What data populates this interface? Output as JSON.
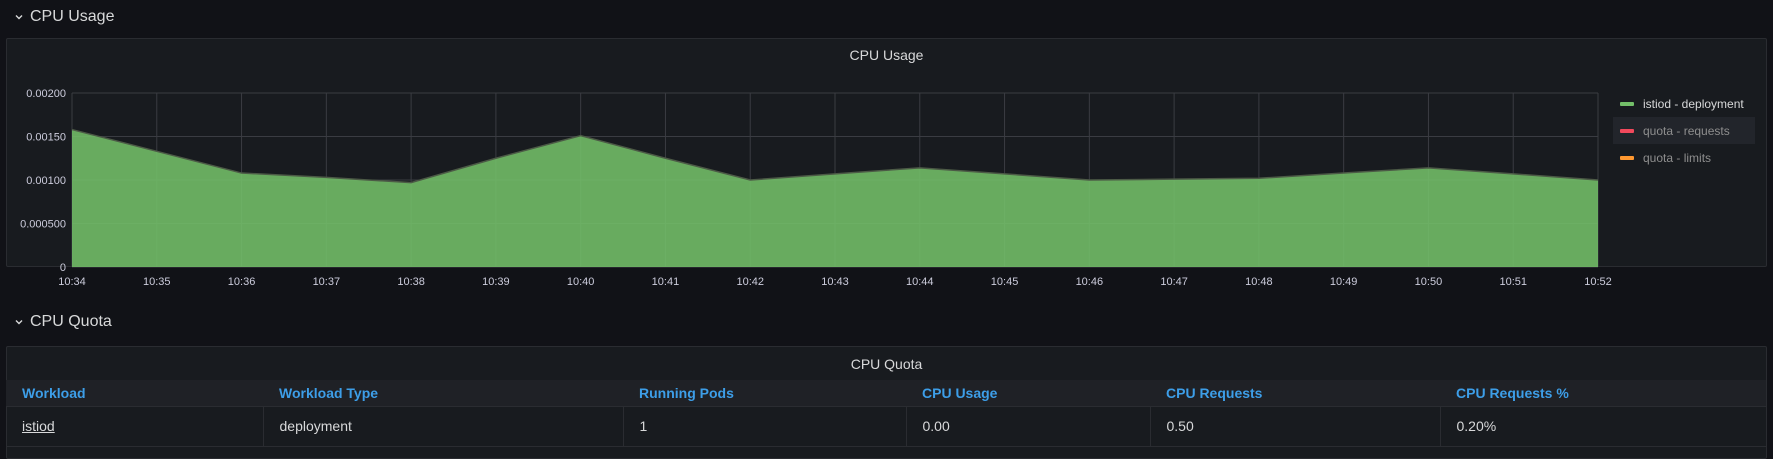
{
  "rows": {
    "cpu_usage": {
      "title": "CPU Usage"
    },
    "cpu_quota": {
      "title": "CPU Quota"
    }
  },
  "usage_panel": {
    "title": "CPU Usage",
    "legend": [
      {
        "label": "istiod - deployment",
        "color": "#73bf69",
        "state": "active"
      },
      {
        "label": "quota - requests",
        "color": "#f2495c",
        "state": "dim"
      },
      {
        "label": "quota - limits",
        "color": "#ff9830",
        "state": "dim"
      }
    ]
  },
  "quota_panel": {
    "title": "CPU Quota",
    "columns": [
      "Workload",
      "Workload Type",
      "Running Pods",
      "CPU Usage",
      "CPU Requests",
      "CPU Requests %"
    ],
    "rows": [
      [
        "istiod",
        "deployment",
        "1",
        "0.00",
        "0.50",
        "0.20%"
      ]
    ]
  },
  "chart_data": {
    "type": "area",
    "title": "CPU Usage",
    "x": [
      "10:34",
      "10:35",
      "10:36",
      "10:37",
      "10:38",
      "10:39",
      "10:40",
      "10:41",
      "10:42",
      "10:43",
      "10:44",
      "10:45",
      "10:46",
      "10:47",
      "10:48",
      "10:49",
      "10:50",
      "10:51",
      "10:52"
    ],
    "y_ticks": [
      "0",
      "0.000500",
      "0.00100",
      "0.00150",
      "0.00200"
    ],
    "ylim": [
      0,
      0.002
    ],
    "grid": true,
    "legend_position": "right",
    "series": [
      {
        "name": "istiod - deployment",
        "color": "#73bf69",
        "values": [
          0.00158,
          0.00133,
          0.00108,
          0.00103,
          0.00097,
          0.00125,
          0.00151,
          0.00125,
          0.001,
          0.00107,
          0.00114,
          0.00107,
          0.001,
          0.00101,
          0.00102,
          0.00108,
          0.00114,
          0.00107,
          0.001
        ]
      }
    ]
  }
}
